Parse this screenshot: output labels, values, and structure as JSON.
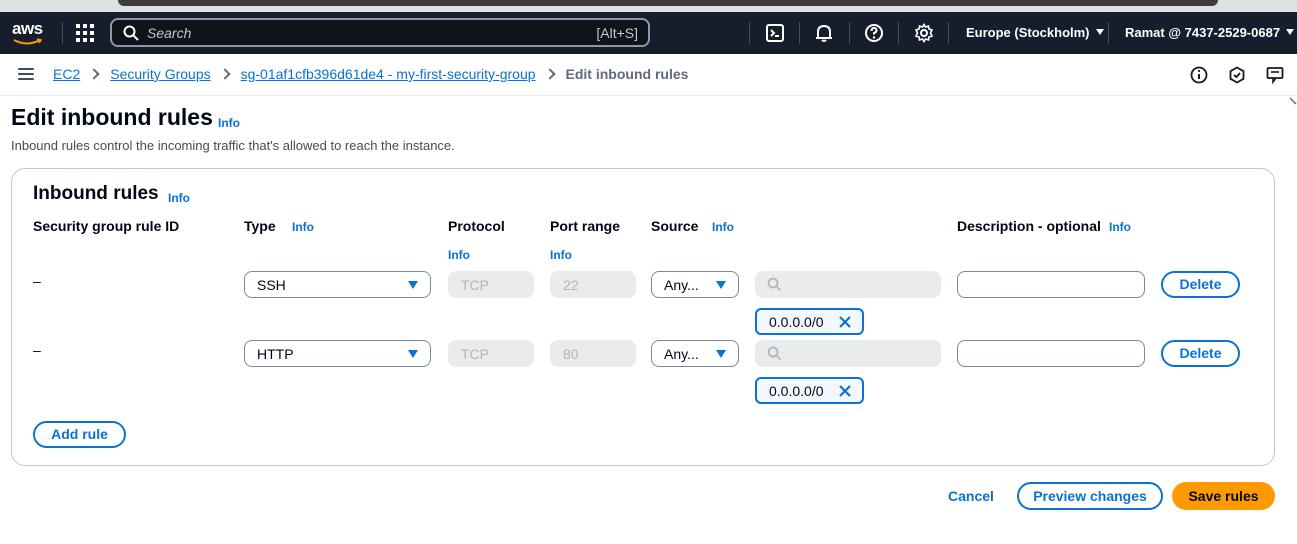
{
  "topnav": {
    "logo_text": "aws",
    "search_placeholder": "Search",
    "search_shortcut": "[Alt+S]",
    "region": "Europe (Stockholm)",
    "account": "Ramat @ 7437-2529-0687",
    "icons": [
      "services-grid-icon",
      "cloudshell-icon",
      "bell-icon",
      "help-icon",
      "settings-icon"
    ]
  },
  "breadcrumb": {
    "items": [
      "EC2",
      "Security Groups",
      "sg-01af1cfb396d61de4 - my-first-security-group"
    ],
    "current": "Edit inbound rules"
  },
  "page": {
    "title": "Edit inbound rules",
    "title_info": "Info",
    "subtitle": "Inbound rules control the incoming traffic that's allowed to reach the instance."
  },
  "panel": {
    "title": "Inbound rules",
    "title_info": "Info",
    "columns": {
      "rule_id": "Security group rule ID",
      "type": "Type",
      "type_info": "Info",
      "protocol": "Protocol",
      "protocol_info": "Info",
      "port_range": "Port range",
      "port_info": "Info",
      "source": "Source",
      "source_info": "Info",
      "description": "Description - optional",
      "description_info": "Info"
    },
    "rules": [
      {
        "rule_id": "–",
        "type": "SSH",
        "protocol": "TCP",
        "port": "22",
        "source": "Any...",
        "cidr": "0.0.0.0/0",
        "delete_label": "Delete"
      },
      {
        "rule_id": "–",
        "type": "HTTP",
        "protocol": "TCP",
        "port": "80",
        "source": "Any...",
        "cidr": "0.0.0.0/0",
        "delete_label": "Delete"
      }
    ],
    "add_rule_label": "Add rule"
  },
  "actions": {
    "cancel": "Cancel",
    "preview": "Preview changes",
    "save": "Save rules"
  },
  "colors": {
    "nav_bg": "#161e2d",
    "link": "#0972d3",
    "primary": "#ff9900"
  }
}
